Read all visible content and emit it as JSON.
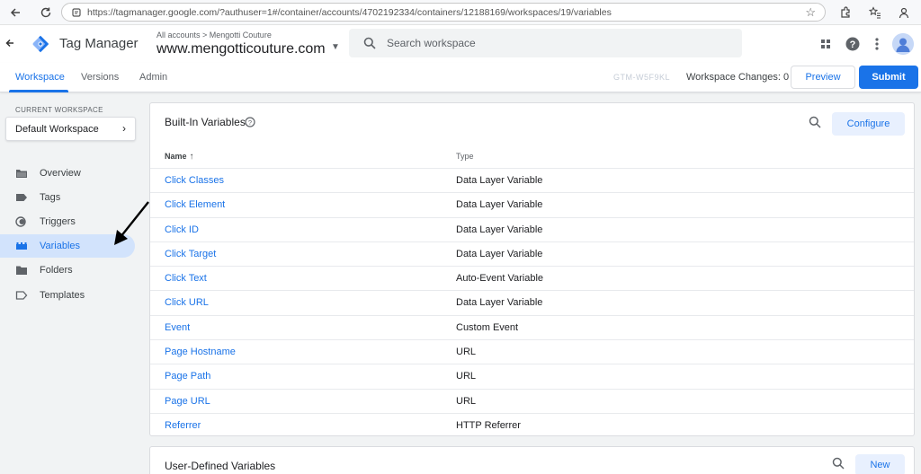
{
  "browser": {
    "url": "https://tagmanager.google.com/?authuser=1#/container/accounts/4702192334/containers/12188169/workspaces/19/variables"
  },
  "header": {
    "brand": "Tag Manager",
    "breadcrumb": "All accounts > Mengotti Couture",
    "container_name": "www.mengotticouture.com",
    "search_placeholder": "Search workspace"
  },
  "tabs": [
    {
      "label": "Workspace",
      "active": true
    },
    {
      "label": "Versions",
      "active": false
    },
    {
      "label": "Admin",
      "active": false
    }
  ],
  "toolbar": {
    "workspace_id": "GTM-W5F9KL",
    "workspace_changes": "Workspace Changes: 0",
    "preview_label": "Preview",
    "submit_label": "Submit"
  },
  "sidebar": {
    "current_workspace_label": "CURRENT WORKSPACE",
    "workspace_name": "Default Workspace",
    "items": [
      {
        "label": "Overview",
        "icon": "folder-open-icon",
        "active": false
      },
      {
        "label": "Tags",
        "icon": "tag-icon",
        "active": false
      },
      {
        "label": "Triggers",
        "icon": "trigger-icon",
        "active": false
      },
      {
        "label": "Variables",
        "icon": "variables-icon",
        "active": true
      },
      {
        "label": "Folders",
        "icon": "folder-icon",
        "active": false
      },
      {
        "label": "Templates",
        "icon": "template-icon",
        "active": false
      }
    ]
  },
  "builtin": {
    "title": "Built-In Variables",
    "configure_label": "Configure",
    "col_name": "Name",
    "col_type": "Type",
    "rows": [
      {
        "name": "Click Classes",
        "type": "Data Layer Variable"
      },
      {
        "name": "Click Element",
        "type": "Data Layer Variable"
      },
      {
        "name": "Click ID",
        "type": "Data Layer Variable"
      },
      {
        "name": "Click Target",
        "type": "Data Layer Variable"
      },
      {
        "name": "Click Text",
        "type": "Auto-Event Variable"
      },
      {
        "name": "Click URL",
        "type": "Data Layer Variable"
      },
      {
        "name": "Event",
        "type": "Custom Event"
      },
      {
        "name": "Page Hostname",
        "type": "URL"
      },
      {
        "name": "Page Path",
        "type": "URL"
      },
      {
        "name": "Page URL",
        "type": "URL"
      },
      {
        "name": "Referrer",
        "type": "HTTP Referrer"
      }
    ]
  },
  "userdefined": {
    "title": "User-Defined Variables",
    "new_label": "New"
  },
  "colors": {
    "accent": "#1a73e8",
    "active_nav_bg": "#d2e3fc"
  }
}
